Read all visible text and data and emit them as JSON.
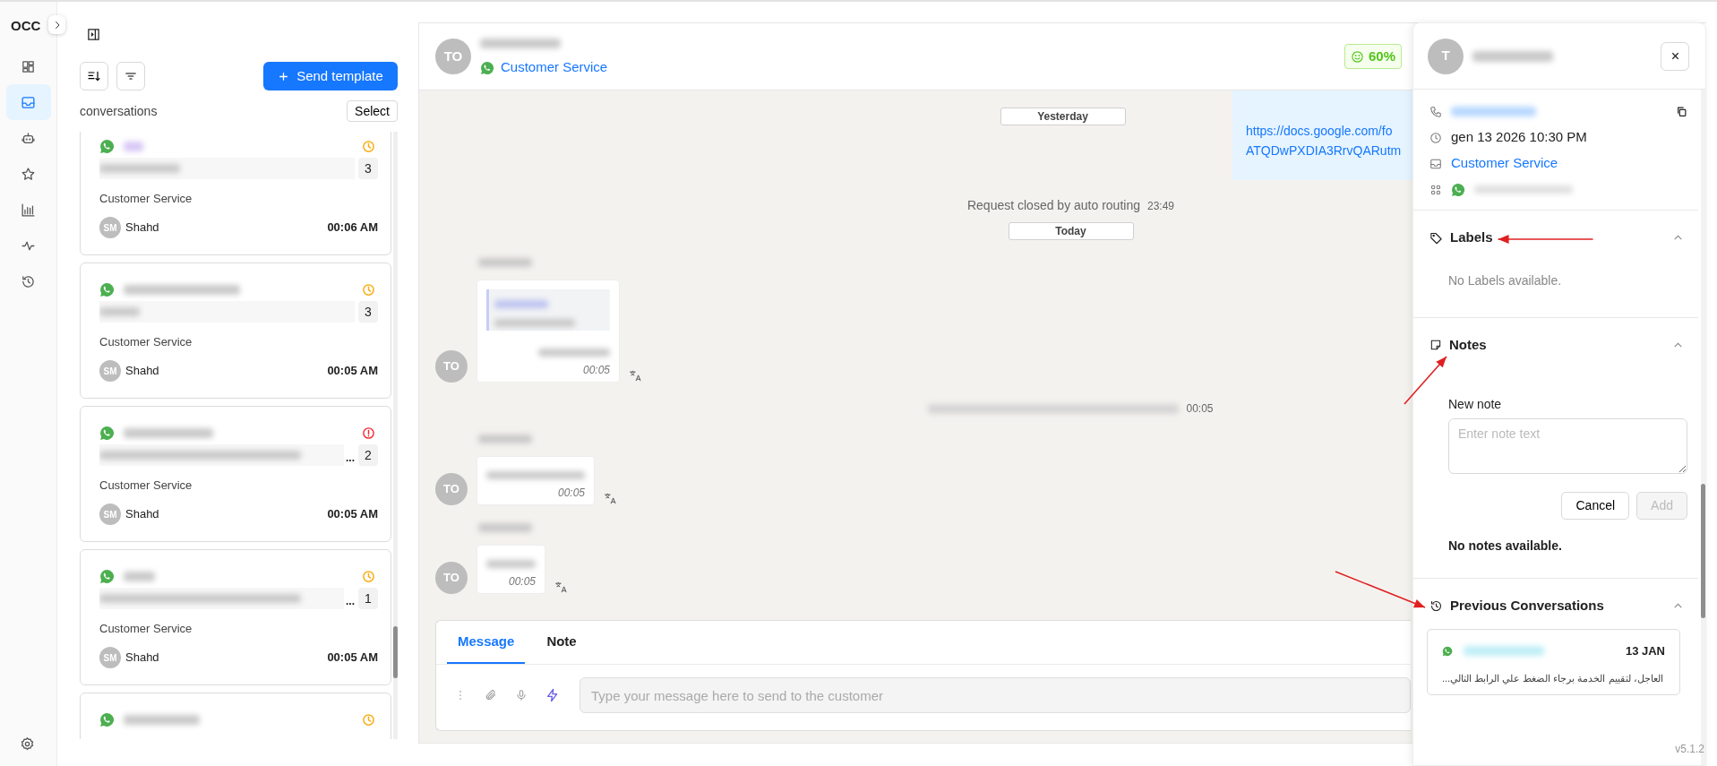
{
  "rail": {
    "logo": "OCC",
    "items": [
      {
        "selected": false
      },
      {
        "selected": true
      },
      {
        "selected": false
      },
      {
        "selected": false
      },
      {
        "selected": false
      },
      {
        "selected": false
      },
      {
        "selected": false
      }
    ]
  },
  "list": {
    "send_template": "Send template",
    "title": "conversations",
    "select": "Select",
    "cards": [
      {
        "kind": "pending",
        "unread": "3",
        "inbox": "Customer Service",
        "agent_initials": "SM",
        "agent": "Shahd",
        "time": "00:06 AM"
      },
      {
        "kind": "pending",
        "unread": "3",
        "inbox": "Customer Service",
        "agent_initials": "SM",
        "agent": "Shahd",
        "time": "00:05 AM"
      },
      {
        "kind": "alert",
        "unread": "2",
        "ellipsis": "...",
        "inbox": "Customer Service",
        "agent_initials": "SM",
        "agent": "Shahd",
        "time": "00:05 AM"
      },
      {
        "kind": "pending",
        "unread": "1",
        "ellipsis": "...",
        "inbox": "Customer Service",
        "agent_initials": "SM",
        "agent": "Shahd",
        "time": "00:05 AM"
      },
      {
        "kind": "pending"
      }
    ]
  },
  "chat": {
    "header": {
      "initials": "TO",
      "inbox": "Customer Service",
      "score": "60%"
    },
    "sticky_date": "Yesterday",
    "messages": [
      {
        "kind": "link",
        "lines": [
          "https://docs.google.com/fo",
          "ATQDwPXDIA3RrvQARutm"
        ]
      },
      {
        "kind": "system",
        "text": "Request closed by auto routing",
        "time": "23:49"
      },
      {
        "kind": "date",
        "text": "Today"
      },
      {
        "kind": "incoming",
        "initials": "TO",
        "quoted": true,
        "time": "00:05"
      },
      {
        "kind": "system",
        "time": "00:05"
      },
      {
        "kind": "incoming",
        "initials": "TO",
        "quoted": false,
        "time": "00:05"
      },
      {
        "kind": "incoming",
        "initials": "TO",
        "quoted": false,
        "time": "00:05"
      }
    ],
    "composer": {
      "tabs": [
        {
          "label": "Message",
          "selected": true
        },
        {
          "label": "Note",
          "selected": false
        }
      ],
      "placeholder": "Type your message here to send to the customer"
    }
  },
  "drawer": {
    "initials": "T",
    "info": [
      {
        "kind": "redacted",
        "copyable": true
      },
      {
        "kind": "text",
        "text": "gen 13 2026 10:30 PM"
      },
      {
        "kind": "link",
        "text": "Customer Service"
      },
      {
        "kind": "channel"
      }
    ],
    "sections": [
      {
        "kind": "labels",
        "title": "Labels",
        "expanded": true,
        "empty_text": "No Labels available."
      },
      {
        "kind": "notes",
        "title": "Notes",
        "expanded": true,
        "field_label": "New note",
        "placeholder": "Enter note text",
        "buttons": [
          {
            "label": "Cancel",
            "disabled": false
          },
          {
            "label": "Add",
            "disabled": true
          }
        ],
        "empty_text": "No notes available."
      },
      {
        "kind": "history",
        "title": "Previous Conversations",
        "expanded": true,
        "items": [
          {
            "date": "13 JAN",
            "preview": "العاجل، لتقييم الخدمة برجاء الضغط علي الرابط التالي..."
          }
        ]
      }
    ]
  },
  "version": "v5.1.2",
  "annotation_arrows": [
    {
      "kind": "arrow"
    },
    {
      "kind": "arrow"
    },
    {
      "kind": "arrow"
    }
  ]
}
